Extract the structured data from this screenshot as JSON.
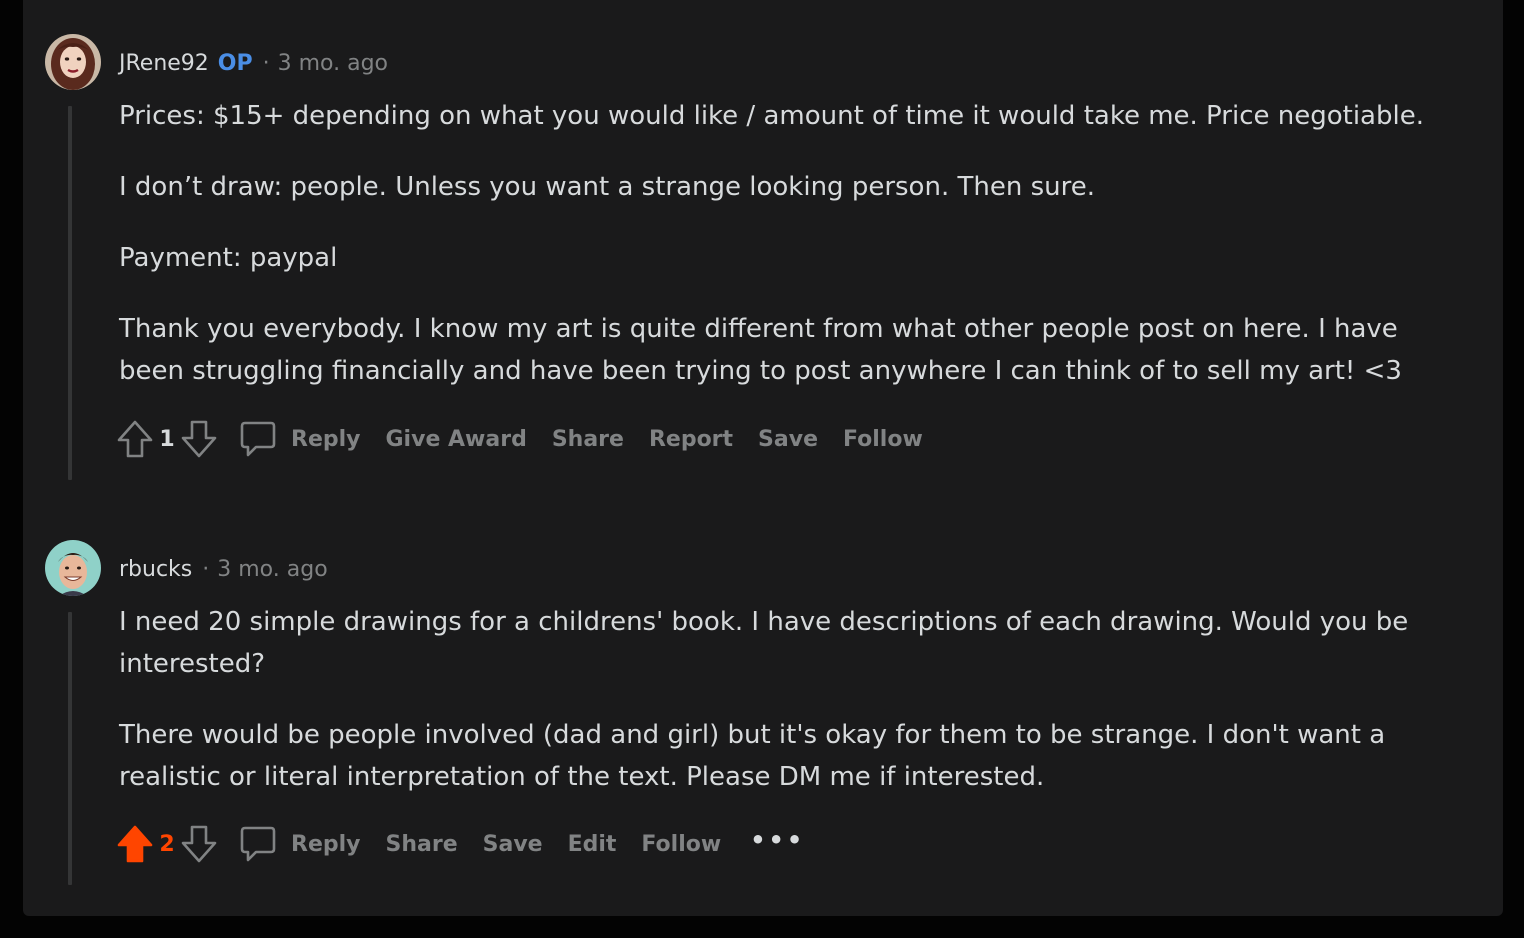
{
  "comments": [
    {
      "author": "JRene92",
      "op_badge": "OP",
      "separator": "·",
      "time": "3 mo. ago",
      "paragraphs": [
        "Prices: $15+ depending on what you would like / amount of time it would take me. Price negotiable.",
        "I don’t draw: people. Unless you want a strange looking person. Then sure.",
        "Payment: paypal",
        "Thank you everybody. I know my art is quite different from what other people post on here. I have been struggling financially and have been trying to post anywhere I can think of to sell my art! <3"
      ],
      "score": "1",
      "upvoted": false,
      "actions": {
        "reply": "Reply",
        "give_award": "Give Award",
        "share": "Share",
        "report": "Report",
        "save": "Save",
        "follow": "Follow"
      }
    },
    {
      "author": "rbucks",
      "separator": "·",
      "time": "3 mo. ago",
      "paragraphs": [
        "I need 20 simple drawings for a childrens' book. I have descriptions of each drawing. Would you be interested?",
        "There would be people involved (dad and girl) but it's okay for them to be strange. I don't want a realistic or literal interpretation of the text. Please DM me if interested."
      ],
      "score": "2",
      "upvoted": true,
      "actions": {
        "reply": "Reply",
        "share": "Share",
        "save": "Save",
        "edit": "Edit",
        "follow": "Follow",
        "more": "•••"
      }
    }
  ],
  "colors": {
    "background": "#1a1a1b",
    "text": "#d7dadc",
    "muted": "#818384",
    "op_badge": "#4a8ee6",
    "upvote_active": "#ff4500"
  },
  "icons": [
    "upvote-arrow-icon",
    "downvote-arrow-icon",
    "comment-bubble-icon",
    "more-options-icon"
  ]
}
